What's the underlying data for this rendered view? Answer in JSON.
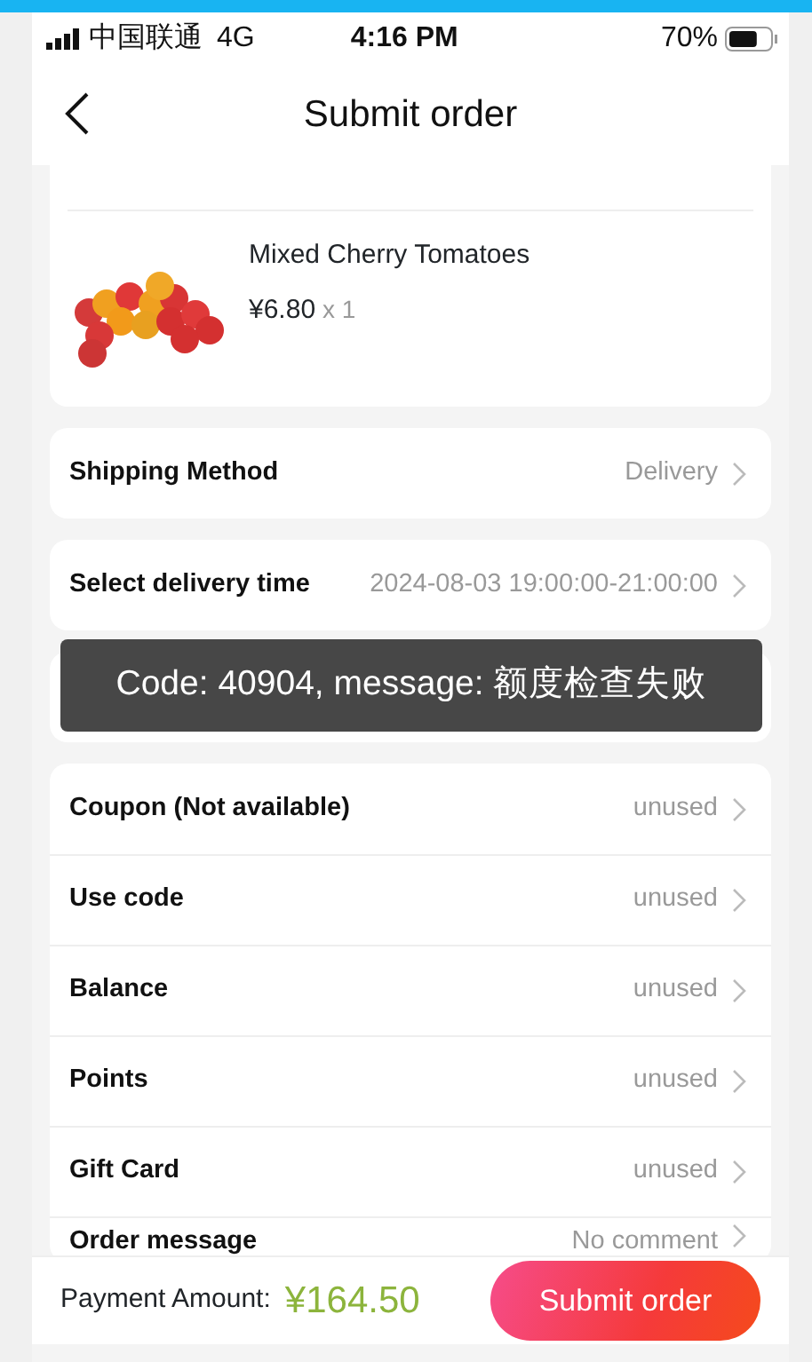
{
  "status_bar": {
    "carrier": "中国联通",
    "network": "4G",
    "time": "4:16 PM",
    "battery": "70%"
  },
  "header": {
    "title": "Submit order"
  },
  "product": {
    "name": "Mixed Cherry Tomatoes",
    "price": "¥6.80",
    "quantity": "x 1"
  },
  "sections": [
    {
      "rows": [
        {
          "label": "Shipping Method",
          "value": "Delivery"
        }
      ]
    },
    {
      "rows": [
        {
          "label": "Select delivery time",
          "value": "2024-08-03 19:00:00-21:00:00"
        }
      ]
    },
    {
      "rows": [
        {
          "label": "Coupon (Not available)",
          "value": "unused"
        },
        {
          "label": "Use code",
          "value": "unused"
        },
        {
          "label": "Balance",
          "value": "unused"
        },
        {
          "label": "Points",
          "value": "unused"
        },
        {
          "label": "Gift Card",
          "value": "unused"
        },
        {
          "label": "Order message",
          "value": "No comment"
        }
      ]
    }
  ],
  "toast": "Code: 40904, message: 额度检查失败",
  "footer": {
    "label": "Payment Amount:",
    "amount": "¥164.50",
    "button": "Submit order"
  }
}
